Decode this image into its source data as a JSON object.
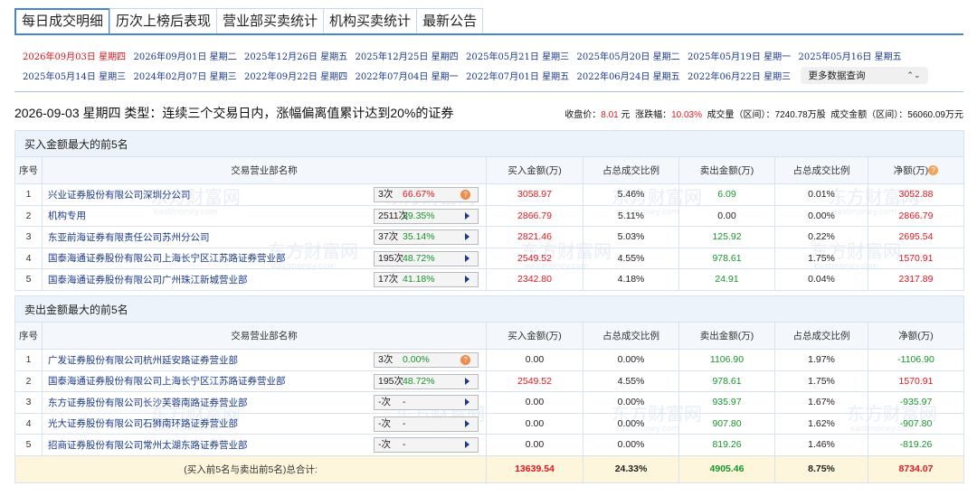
{
  "tabs": [
    "每日成交明细",
    "历次上榜后表现",
    "营业部买卖统计",
    "机构买卖统计",
    "最新公告"
  ],
  "dates": {
    "row1": [
      "2026年09月03日 星期四",
      "2026年09月01日 星期二",
      "2025年12月26日 星期五",
      "2025年12月25日 星期四",
      "2025年05月21日 星期三",
      "2025年05月20日 星期二",
      "2025年05月19日 星期一",
      "2025年05月16日 星期五"
    ],
    "row2": [
      "2025年05月14日 星期三",
      "2024年02月07日 星期三",
      "2022年09月22日 星期四",
      "2022年07月04日 星期一",
      "2022年07月01日 星期五",
      "2022年06月24日 星期五",
      "2022年06月22日 星期三"
    ],
    "more_label": "更多数据查询",
    "updown_icon": "⌃⌄"
  },
  "info": {
    "left": "2026-09-03 星期四 类型：连续三个交易日内，涨幅偏离值累计达到20%的证券",
    "close_label": "收盘价：",
    "close_value": "8.01",
    "close_unit": "元",
    "change_label": "涨跌幅：",
    "change_value": "10.03%",
    "volume_label": "成交量（区间）：",
    "volume_value": "7240.78万股",
    "amount_label": "成交金额（区间）：",
    "amount_value": "56060.09万元"
  },
  "buy_section": {
    "title": "买入金额最大的前5名",
    "headers": [
      "序号",
      "交易营业部名称",
      "买入金额(万)",
      "占总成交比例",
      "卖出金额(万)",
      "占总成交比例",
      "净额(万)"
    ],
    "rows": [
      {
        "no": "1",
        "name": "兴业证券股份有限公司深圳分公司",
        "cnt": "3次",
        "pct": "66.67%",
        "pct_color": "red",
        "icon": "dot",
        "buy": "3058.97",
        "buy_ratio": "5.46%",
        "sell": "6.09",
        "sell_ratio": "0.01%",
        "net": "3052.88"
      },
      {
        "no": "2",
        "name": "机构专用",
        "cnt": "2511次",
        "pct": "39.35%",
        "pct_color": "green",
        "icon": "play",
        "buy": "2866.79",
        "buy_ratio": "5.11%",
        "sell": "0.00",
        "sell_ratio": "0.00%",
        "net": "2866.79"
      },
      {
        "no": "3",
        "name": "东亚前海证券有限责任公司苏州分公司",
        "cnt": "37次",
        "pct": "35.14%",
        "pct_color": "green",
        "icon": "play",
        "buy": "2821.46",
        "buy_ratio": "5.03%",
        "sell": "125.92",
        "sell_ratio": "0.22%",
        "net": "2695.54"
      },
      {
        "no": "4",
        "name": "国泰海通证券股份有限公司上海长宁区江苏路证券营业部",
        "cnt": "195次",
        "pct": "48.72%",
        "pct_color": "green",
        "icon": "play",
        "buy": "2549.52",
        "buy_ratio": "4.55%",
        "sell": "978.61",
        "sell_ratio": "1.75%",
        "net": "1570.91"
      },
      {
        "no": "5",
        "name": "国泰海通证券股份有限公司广州珠江新城营业部",
        "cnt": "17次",
        "pct": "41.18%",
        "pct_color": "green",
        "icon": "play",
        "buy": "2342.80",
        "buy_ratio": "4.18%",
        "sell": "24.91",
        "sell_ratio": "0.04%",
        "net": "2317.89"
      }
    ]
  },
  "sell_section": {
    "title": "卖出金额最大的前5名",
    "headers": [
      "序号",
      "交易营业部名称",
      "买入金额(万)",
      "占总成交比例",
      "卖出金额(万)",
      "占总成交比例",
      "净额(万)"
    ],
    "rows": [
      {
        "no": "1",
        "name": "广发证券股份有限公司杭州延安路证券营业部",
        "cnt": "3次",
        "pct": "0.00%",
        "pct_color": "green",
        "icon": "dot",
        "buy": "0.00",
        "buy_ratio": "0.00%",
        "sell": "1106.90",
        "sell_ratio": "1.97%",
        "net": "-1106.90"
      },
      {
        "no": "2",
        "name": "国泰海通证券股份有限公司上海长宁区江苏路证券营业部",
        "cnt": "195次",
        "pct": "48.72%",
        "pct_color": "green",
        "icon": "play",
        "buy": "2549.52",
        "buy_ratio": "4.55%",
        "sell": "978.61",
        "sell_ratio": "1.75%",
        "net": "1570.91"
      },
      {
        "no": "3",
        "name": "东方证券股份有限公司长沙芙蓉南路证券营业部",
        "cnt": "-次",
        "pct": "-",
        "pct_color": "dark",
        "icon": "play",
        "buy": "0.00",
        "buy_ratio": "0.00%",
        "sell": "935.97",
        "sell_ratio": "1.67%",
        "net": "-935.97"
      },
      {
        "no": "4",
        "name": "光大证券股份有限公司石狮南环路证券营业部",
        "cnt": "-次",
        "pct": "-",
        "pct_color": "dark",
        "icon": "play",
        "buy": "0.00",
        "buy_ratio": "0.00%",
        "sell": "907.80",
        "sell_ratio": "1.62%",
        "net": "-907.80"
      },
      {
        "no": "5",
        "name": "招商证券股份有限公司常州太湖东路证券营业部",
        "cnt": "-次",
        "pct": "-",
        "pct_color": "dark",
        "icon": "play",
        "buy": "0.00",
        "buy_ratio": "0.00%",
        "sell": "819.26",
        "sell_ratio": "1.46%",
        "net": "-819.26"
      }
    ]
  },
  "total": {
    "label": "(买入前5名与卖出前5名)总合计:",
    "buy": "13639.54",
    "buy_ratio": "24.33%",
    "sell": "4905.46",
    "sell_ratio": "8.75%",
    "net": "8734.07"
  },
  "watermark": {
    "cn": "东方财富网",
    "en": "eastmoney.com"
  },
  "colors": {
    "accent_blue": "#4a86c5",
    "link_blue": "#1b3a8c",
    "red": "#e3161c",
    "green": "#16952a",
    "total_bg": "#fdf6dc"
  },
  "icons": {
    "dot": "?",
    "help": "?"
  }
}
